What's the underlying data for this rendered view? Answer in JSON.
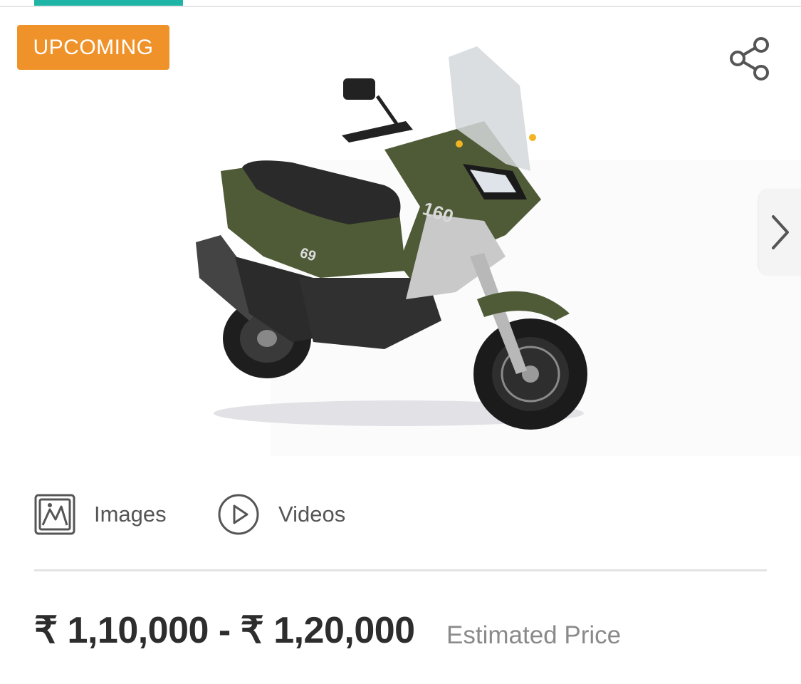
{
  "colors": {
    "tab_accent": "#1fb5a6",
    "badge_bg": "#f0922a",
    "icon_grey": "#555555",
    "scooter_body": "#4f5a37",
    "scooter_dark": "#2a2a2a",
    "scooter_silver": "#c9c9c9"
  },
  "badge": {
    "label": "UPCOMING"
  },
  "gallery": {
    "share_icon": "share-icon",
    "next_icon": "chevron-right-icon",
    "scooter_decal_1": "160",
    "scooter_decal_2": "69"
  },
  "media": {
    "images": {
      "label": "Images",
      "icon": "image-icon"
    },
    "videos": {
      "label": "Videos",
      "icon": "play-circle-icon"
    }
  },
  "price": {
    "range": "₹ 1,10,000 - ₹ 1,20,000",
    "note": "Estimated Price"
  }
}
